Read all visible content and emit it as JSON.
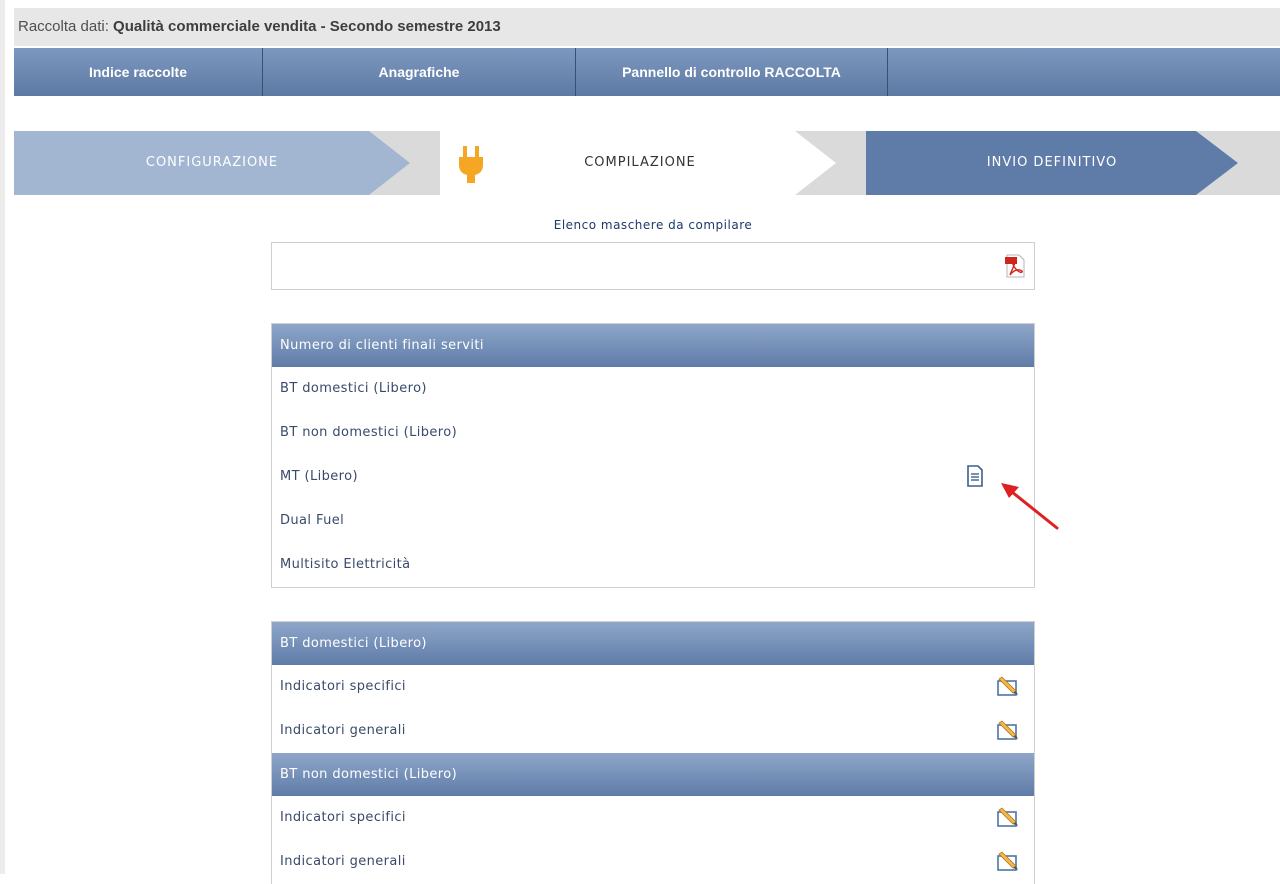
{
  "header": {
    "prefix": "Raccolta dati: ",
    "title": "Qualità commerciale vendita - Secondo semestre 2013"
  },
  "nav": {
    "tabs": [
      {
        "label": "Indice raccolte"
      },
      {
        "label": "Anagrafiche"
      },
      {
        "label": "Pannello di controllo RACCOLTA"
      }
    ]
  },
  "steps": [
    {
      "label": "CONFIGURAZIONE"
    },
    {
      "label": "COMPILAZIONE"
    },
    {
      "label": "INVIO DEFINITIVO"
    }
  ],
  "elenco": {
    "label": "Elenco maschere da compilare",
    "pdf_icon": "pdf-icon"
  },
  "panels": [
    {
      "title": "Numero di clienti finali serviti",
      "rows": [
        {
          "label": "BT domestici (Libero)"
        },
        {
          "label": "BT non domestici (Libero)"
        },
        {
          "label": "MT (Libero)",
          "icon": "document-icon"
        },
        {
          "label": "Dual Fuel"
        },
        {
          "label": "Multisito Elettricità"
        }
      ]
    },
    {
      "title": "BT domestici (Libero)",
      "rows": [
        {
          "label": "Indicatori specifici",
          "icon": "edit-icon"
        },
        {
          "label": "Indicatori generali",
          "icon": "edit-icon"
        }
      ]
    },
    {
      "title": "BT non domestici (Libero)",
      "rows": [
        {
          "label": "Indicatori specifici",
          "icon": "edit-icon"
        },
        {
          "label": "Indicatori generali",
          "icon": "edit-icon"
        }
      ]
    }
  ],
  "colors": {
    "nav": "#5f7ca8",
    "step_done": "#a2b6d2",
    "step_next": "#5f7ca8",
    "plug": "#f5a623",
    "arrow": "#e02020"
  }
}
